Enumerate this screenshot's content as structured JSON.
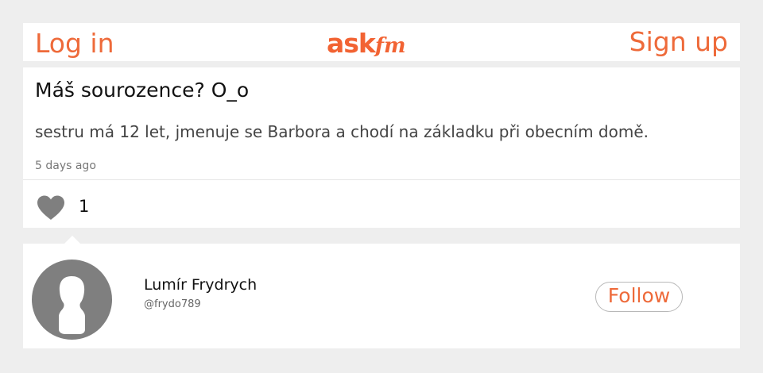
{
  "header": {
    "login_label": "Log in",
    "signup_label": "Sign up",
    "logo_ask": "ask",
    "logo_fm": "fm"
  },
  "question": {
    "title": "Máš sourozence? O_o",
    "answer": "sestru má 12 let, jmenuje se Barbora a chodí na základku při obecním domě.",
    "time_ago": "5 days ago",
    "like_icon": "heart-icon",
    "like_count": "1"
  },
  "profile": {
    "avatar_icon": "default-avatar-silhouette",
    "name": "Lumír Frydrych",
    "handle": "@frydo789",
    "follow_label": "Follow"
  },
  "colors": {
    "accent": "#ee6a3a",
    "background": "#eeeeee",
    "card": "#ffffff",
    "icon_gray": "#7f7f7f"
  }
}
